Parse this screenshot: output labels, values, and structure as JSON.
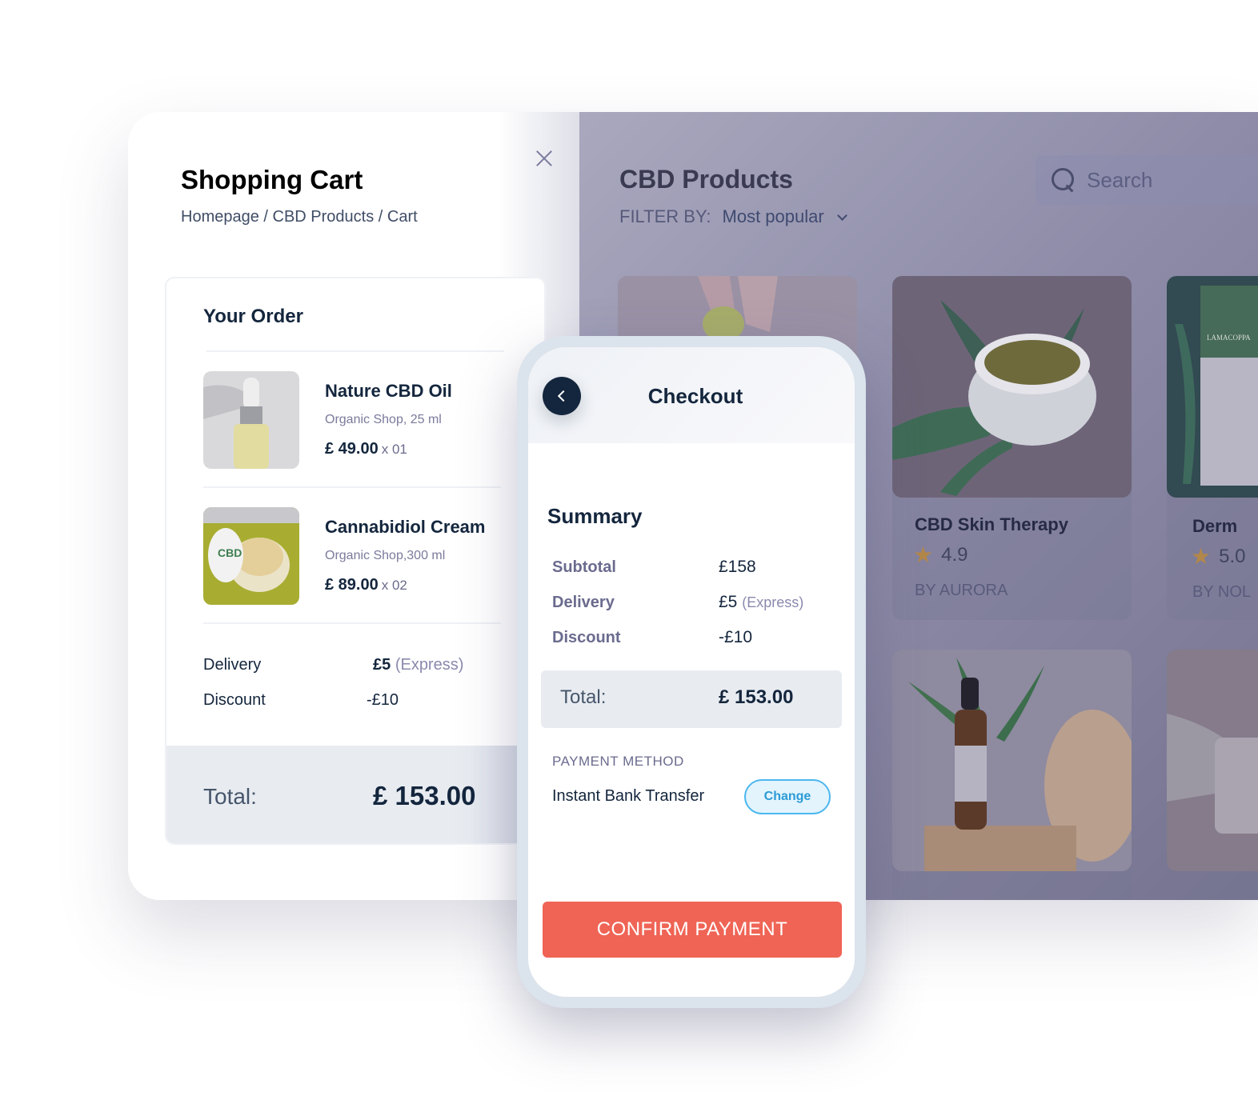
{
  "cart": {
    "title": "Shopping Cart",
    "breadcrumb": "Homepage / CBD Products / Cart",
    "order_title": "Your Order",
    "items": [
      {
        "name": "Nature CBD Oil",
        "shop": "Organic Shop, 25 ml",
        "price": "£ 49.00",
        "qty": "x 01",
        "image": "cbd-oil-dropper-bottle"
      },
      {
        "name": "Cannabidiol Cream",
        "shop": "Organic Shop,300 ml",
        "price": "£ 89.00",
        "qty": "x 02",
        "image": "cbd-cream-jar"
      }
    ],
    "delivery_label": "Delivery",
    "delivery_value": "£5",
    "delivery_note": "(Express)",
    "discount_label": "Discount",
    "discount_value": "-£10",
    "total_label": "Total:",
    "total_value": "£ 153.00"
  },
  "shop": {
    "title": "CBD Products",
    "filter_label": "FILTER BY:",
    "filter_value": "Most popular",
    "search_placeholder": "Search",
    "products": [
      {
        "name": "",
        "rating": "",
        "by": "",
        "image": "cbd-gummy"
      },
      {
        "name": "CBD Skin Therapy",
        "rating": "4.9",
        "by": "BY AURORA",
        "image": "cbd-cream-jar-leaf"
      },
      {
        "name": "Derm",
        "rating": "5.0",
        "by": "BY NOL",
        "image": "lamacoppa-hemp-extract-box"
      },
      {
        "name": "",
        "rating": "",
        "by": "",
        "image": "premium-cbd-oil-bottle"
      },
      {
        "name": "",
        "rating": "",
        "by": "",
        "image": "cbd-jar"
      }
    ]
  },
  "checkout": {
    "title": "Checkout",
    "summary_title": "Summary",
    "rows": [
      {
        "label": "Subtotal",
        "value": "£158",
        "note": ""
      },
      {
        "label": "Delivery",
        "value": "£5",
        "note": "(Express)"
      },
      {
        "label": "Discount",
        "value": "-£10",
        "note": ""
      }
    ],
    "total_label": "Total:",
    "total_value": "£ 153.00",
    "payment_method_label": "PAYMENT METHOD",
    "payment_method_value": "Instant Bank Transfer",
    "change_label": "Change",
    "confirm_label": "CONFIRM PAYMENT"
  },
  "colors": {
    "primary_dark": "#14263d",
    "confirm": "#ef6455",
    "change_border": "#4bb7ef",
    "star": "#b3874a"
  }
}
